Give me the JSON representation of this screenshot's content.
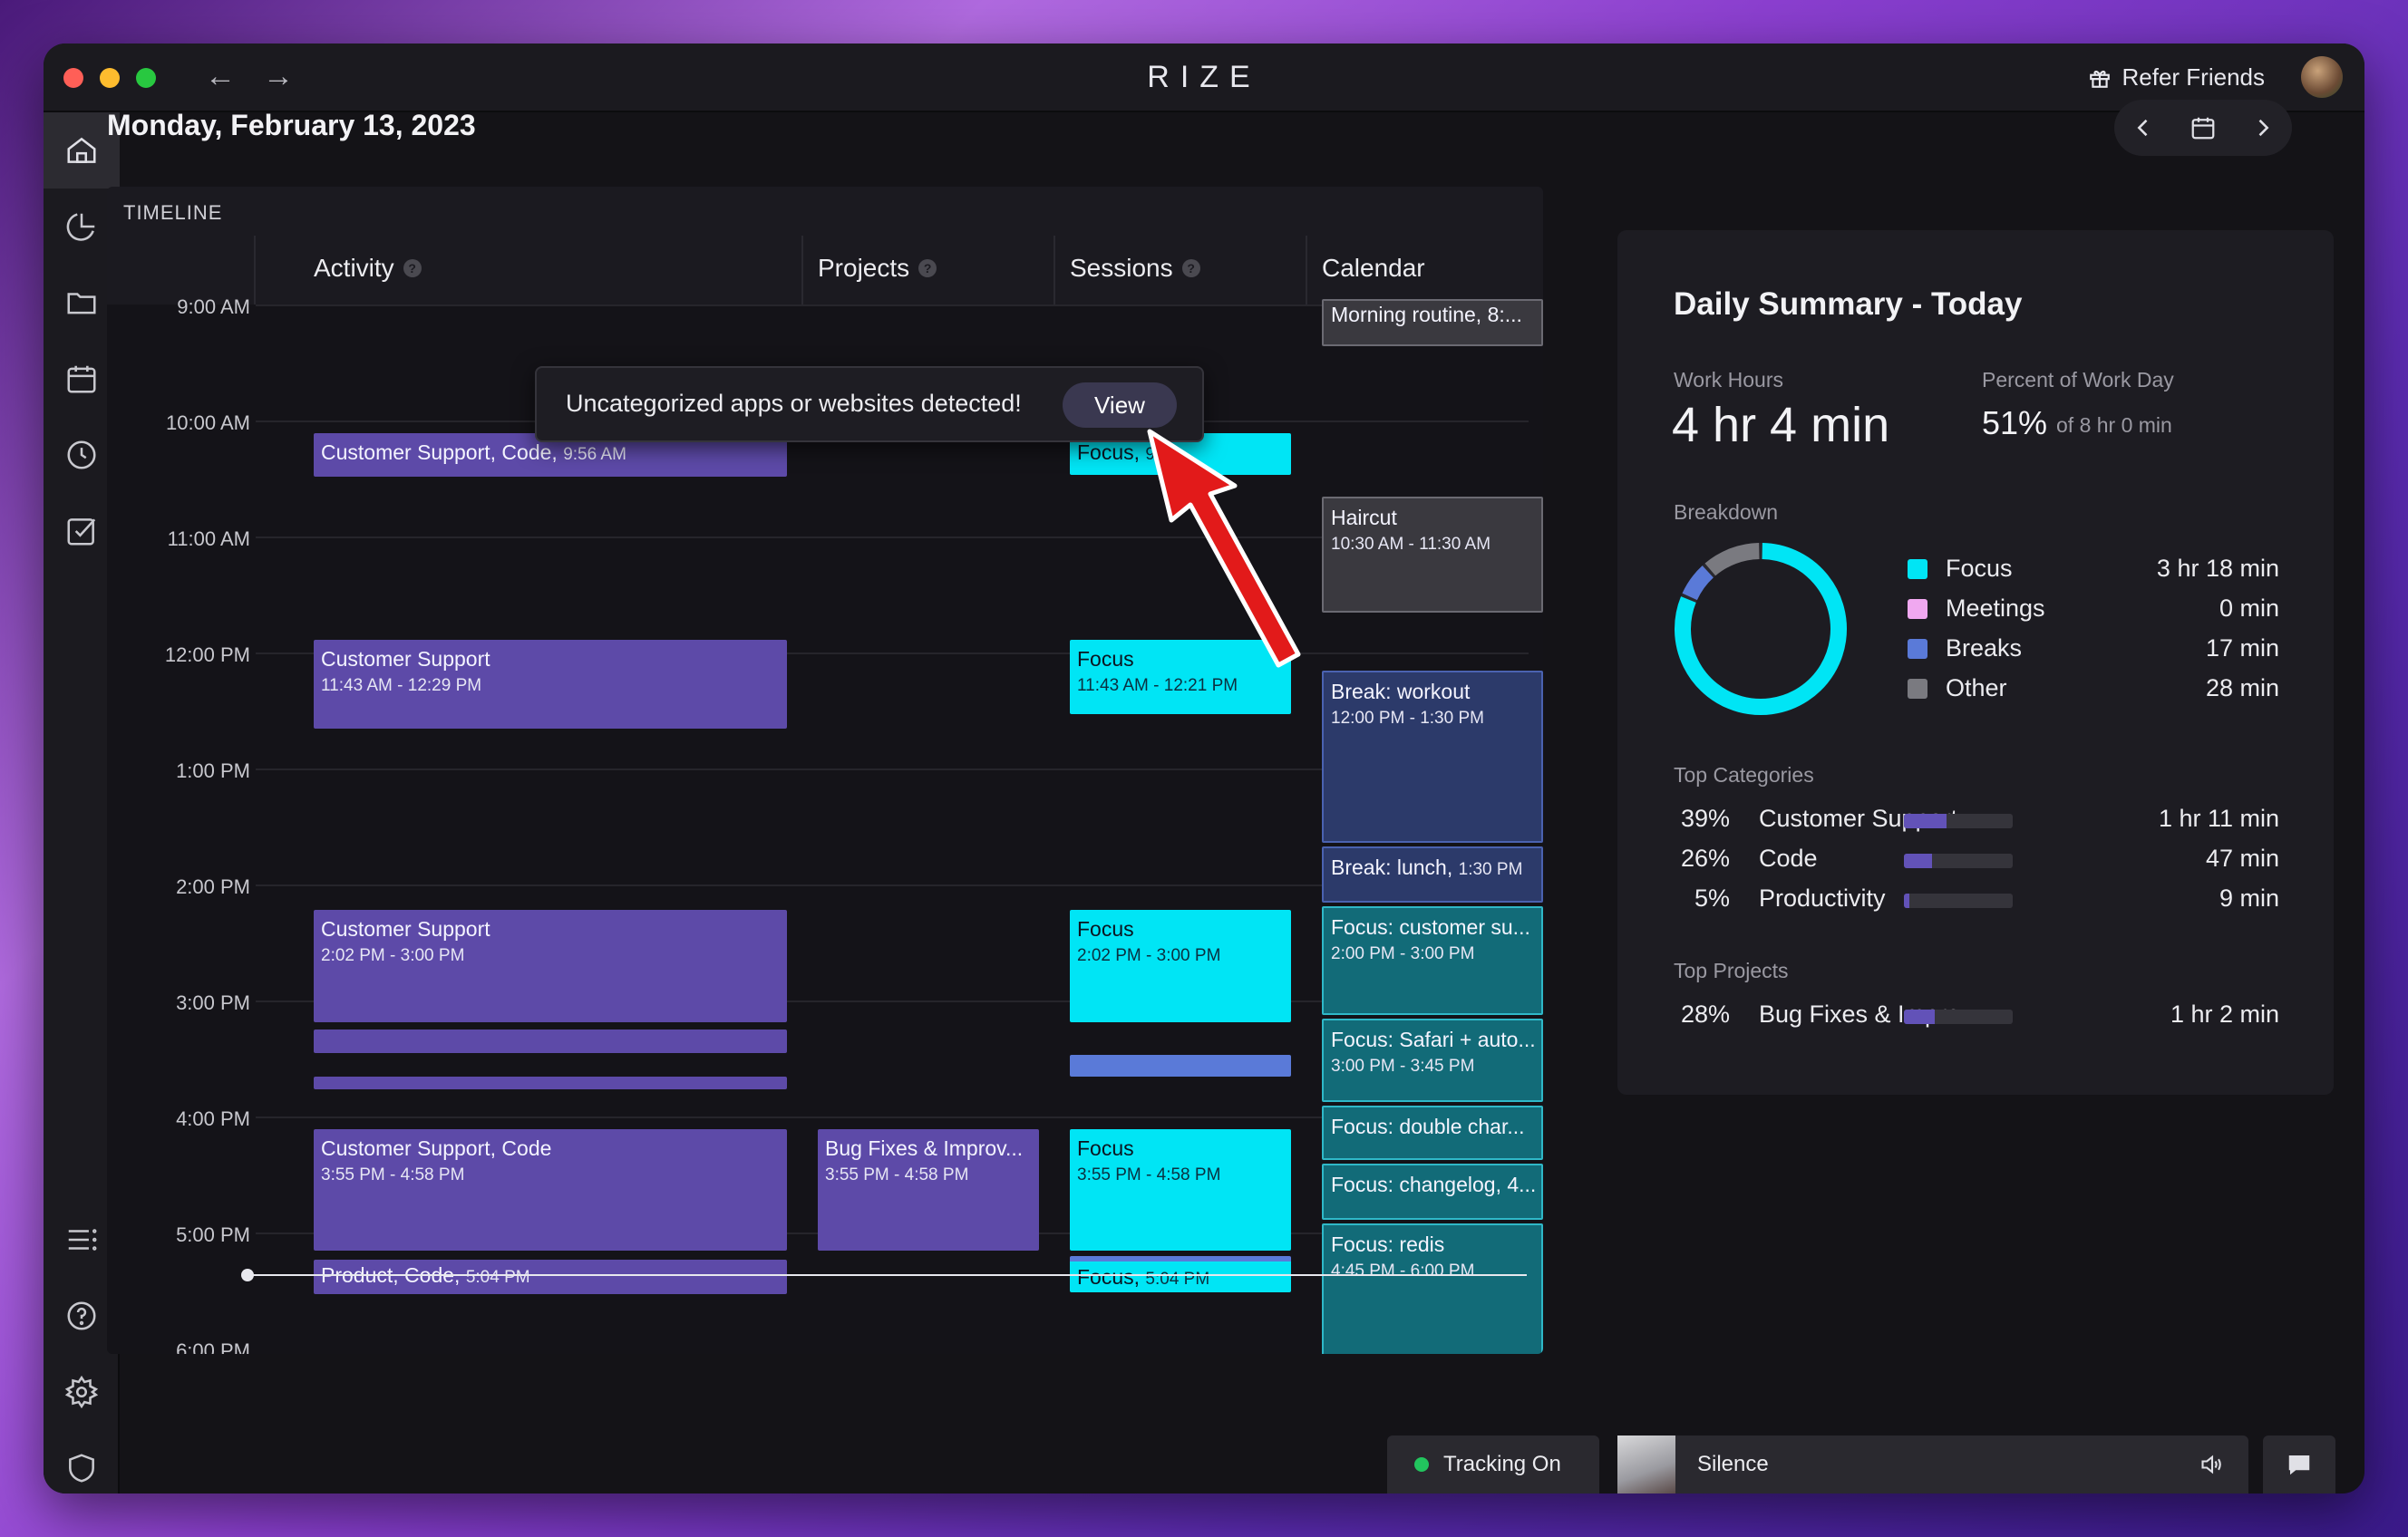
{
  "app": {
    "brand": "RIZE",
    "refer_label": "Refer Friends"
  },
  "header": {
    "date": "Monday, February 13, 2023"
  },
  "timeline": {
    "title": "TIMELINE",
    "columns": [
      {
        "label": "Activity"
      },
      {
        "label": "Projects"
      },
      {
        "label": "Sessions"
      },
      {
        "label": "Calendar"
      }
    ],
    "hours": [
      "9:00 AM",
      "10:00 AM",
      "11:00 AM",
      "12:00 PM",
      "1:00 PM",
      "2:00 PM",
      "3:00 PM",
      "4:00 PM",
      "5:00 PM",
      "6:00 PM"
    ],
    "activity": [
      {
        "title": "Customer Support, Code",
        "time": "9:56 AM",
        "inline": true
      },
      {
        "title": "Customer Support",
        "time": "11:43 AM - 12:29 PM"
      },
      {
        "title": "Customer Support",
        "time": "2:02 PM - 3:00 PM"
      },
      {
        "title": "Customer Support, Code",
        "time": "3:55 PM - 4:58 PM"
      },
      {
        "title": "Product, Code",
        "time": "5:04 PM",
        "inline": true
      }
    ],
    "projects": [
      {
        "title": "Bug Fixes & Improv...",
        "time": "3:55 PM - 4:58 PM"
      }
    ],
    "sessions": [
      {
        "title": "Focus",
        "time": "9:",
        "inline": true
      },
      {
        "title": "Focus",
        "time": "11:43 AM - 12:21 PM"
      },
      {
        "title": "Focus",
        "time": "2:02 PM - 3:00 PM"
      },
      {
        "title": "Focus",
        "time": "3:55 PM - 4:58 PM"
      },
      {
        "title": "Focus",
        "time": "5:04 PM",
        "inline": true
      }
    ],
    "calendar": [
      {
        "title": "Morning routine, 8:..."
      },
      {
        "title": "Haircut",
        "time": "10:30 AM - 11:30 AM"
      },
      {
        "title": "Break: workout",
        "time": "12:00 PM - 1:30 PM"
      },
      {
        "title": "Break: lunch",
        "time": "1:30 PM",
        "inline": true
      },
      {
        "title": "Focus: customer su...",
        "time": "2:00 PM - 3:00 PM"
      },
      {
        "title": "Focus: Safari + auto...",
        "time": "3:00 PM - 3:45 PM"
      },
      {
        "title": "Focus: double char..."
      },
      {
        "title": "Focus: changelog, 4..."
      },
      {
        "title": "Focus: redis",
        "time": "4:45 PM - 6:00 PM"
      }
    ]
  },
  "toast": {
    "message": "Uncategorized apps or websites detected!",
    "button": "View"
  },
  "summary": {
    "title": "Daily Summary - Today",
    "work_hours_label": "Work Hours",
    "work_hours": "4 hr 4 min",
    "percent_label": "Percent of Work Day",
    "percent": "51%",
    "percent_of": "of 8 hr 0 min",
    "breakdown_label": "Breakdown",
    "breakdown": [
      {
        "name": "Focus",
        "value": "3 hr 18 min",
        "color": "#00e5f5",
        "minutes": 198
      },
      {
        "name": "Meetings",
        "value": "0 min",
        "color": "#f0a8f0",
        "minutes": 0
      },
      {
        "name": "Breaks",
        "value": "17 min",
        "color": "#5a7ad8",
        "minutes": 17
      },
      {
        "name": "Other",
        "value": "28 min",
        "color": "#7a7a80",
        "minutes": 28
      }
    ],
    "top_categories_label": "Top Categories",
    "top_categories": [
      {
        "pct": "39%",
        "name": "Customer Support",
        "value": "1 hr 11 min",
        "fraction": 0.39
      },
      {
        "pct": "26%",
        "name": "Code",
        "value": "47 min",
        "fraction": 0.26
      },
      {
        "pct": "5%",
        "name": "Productivity",
        "value": "9 min",
        "fraction": 0.05
      }
    ],
    "top_projects_label": "Top Projects",
    "top_projects": [
      {
        "pct": "28%",
        "name": "Bug Fixes & Impro...",
        "value": "1 hr 2 min",
        "fraction": 0.28
      }
    ]
  },
  "footer": {
    "tracking": "Tracking On",
    "music": "Silence"
  },
  "colors": {
    "accent": "#00e5f5",
    "activity": "#5d4aa8",
    "tracking_dot": "#22c55e"
  }
}
